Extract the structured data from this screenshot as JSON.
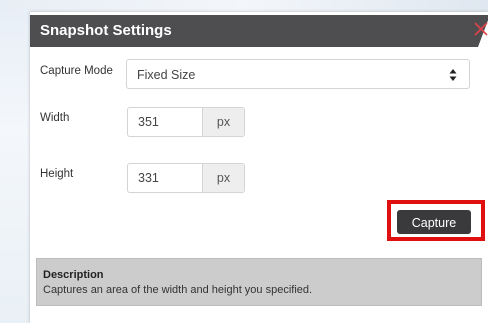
{
  "dialog": {
    "title": "Snapshot Settings"
  },
  "icons": {
    "close": "close-icon",
    "select_arrows": "sort-arrows-icon"
  },
  "colors": {
    "title_bar": "#4e4e50",
    "capture_button": "#3a3a3c",
    "highlight": "#e01010",
    "description_bg": "#cccccc",
    "close_icon": "#e0414a"
  },
  "form": {
    "capture_mode": {
      "label": "Capture Mode",
      "value": "Fixed Size"
    },
    "width": {
      "label": "Width",
      "value": "351",
      "unit": "px"
    },
    "height": {
      "label": "Height",
      "value": "331",
      "unit": "px"
    },
    "capture_button": "Capture"
  },
  "description": {
    "title": "Description",
    "text": "Captures an area of the width and height you specified."
  }
}
